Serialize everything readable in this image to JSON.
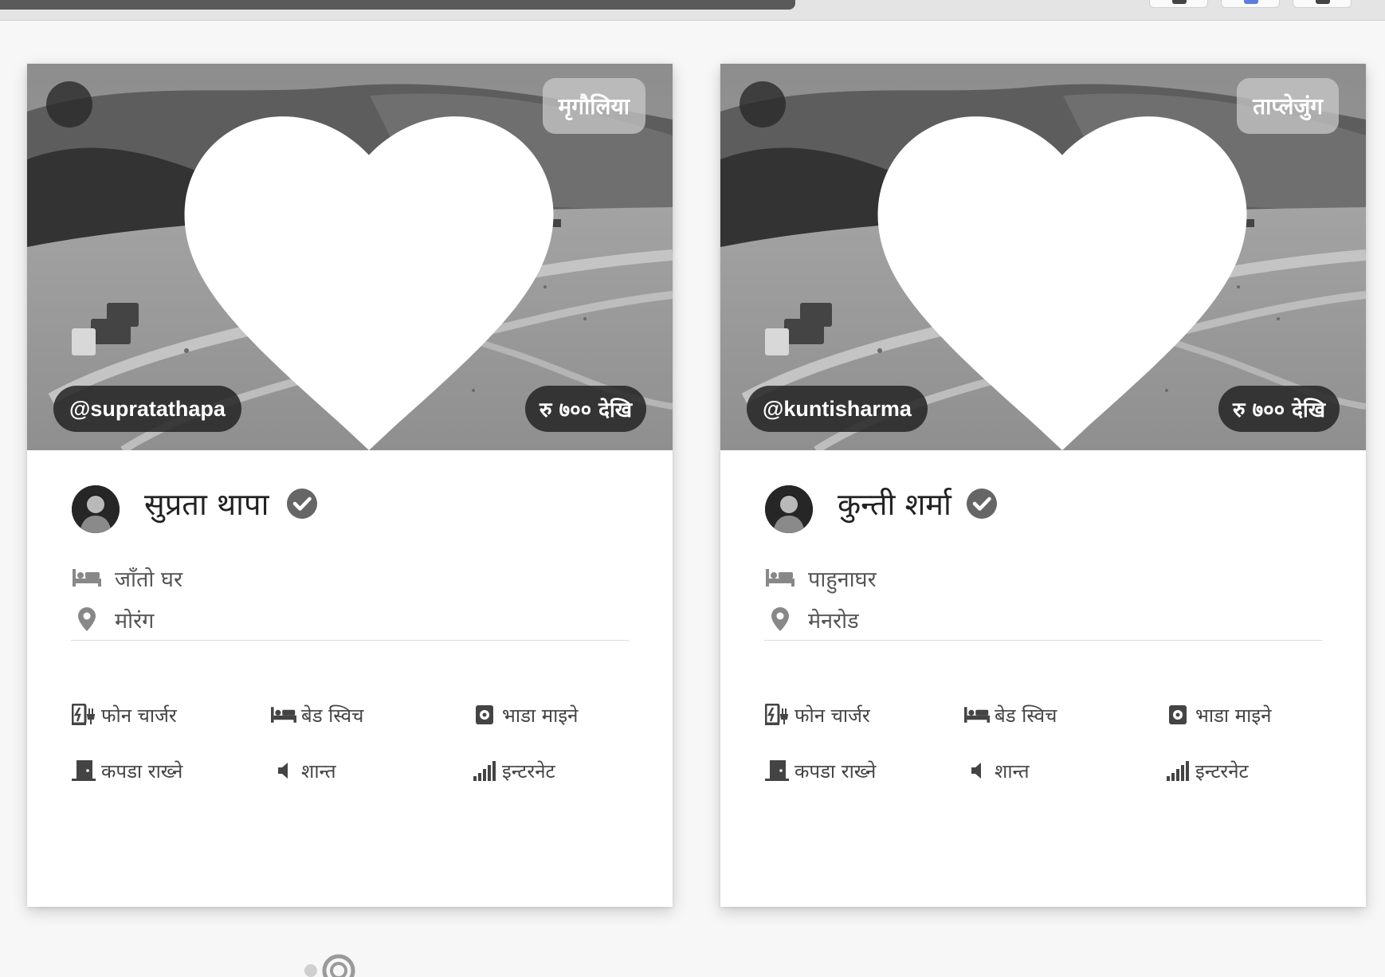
{
  "cards": [
    {
      "region": "मृगौलिया",
      "username": "@supratathapa",
      "price": "रु ७०० देखि",
      "host_name": "सुप्रता थापा",
      "stay_type": "जाँतो घर",
      "location": "मोरंग",
      "amenities": {
        "phone_charger": "फोन चार्जर",
        "bed_switch": "बेड स्विच",
        "rent_ask": "भाडा माइने",
        "cloth_store": "कपडा राख्ने",
        "quiet": "शान्त",
        "internet": "इन्टरनेट"
      }
    },
    {
      "region": "ताप्लेजुंग",
      "username": "@kuntisharma",
      "price": "रु ७०० देखि",
      "host_name": "कुन्ती शर्मा",
      "stay_type": "पाहुनाघर",
      "location": "मेनरोड",
      "amenities": {
        "phone_charger": "फोन चार्जर",
        "bed_switch": "बेड स्विच",
        "rent_ask": "भाडा माइने",
        "cloth_store": "कपडा राख्ने",
        "quiet": "शान्त",
        "internet": "इन्टरनेट"
      }
    }
  ],
  "icons": {
    "favorite": "heart-icon",
    "verified": "check-circle-icon",
    "stay_type": "bed-icon",
    "location": "map-pin-icon",
    "phone_charger": "phone-charger-icon",
    "bed_switch": "bed-icon",
    "rent_ask": "safe-icon",
    "cloth_store": "door-icon",
    "quiet": "speaker-icon",
    "internet": "signal-icon"
  }
}
